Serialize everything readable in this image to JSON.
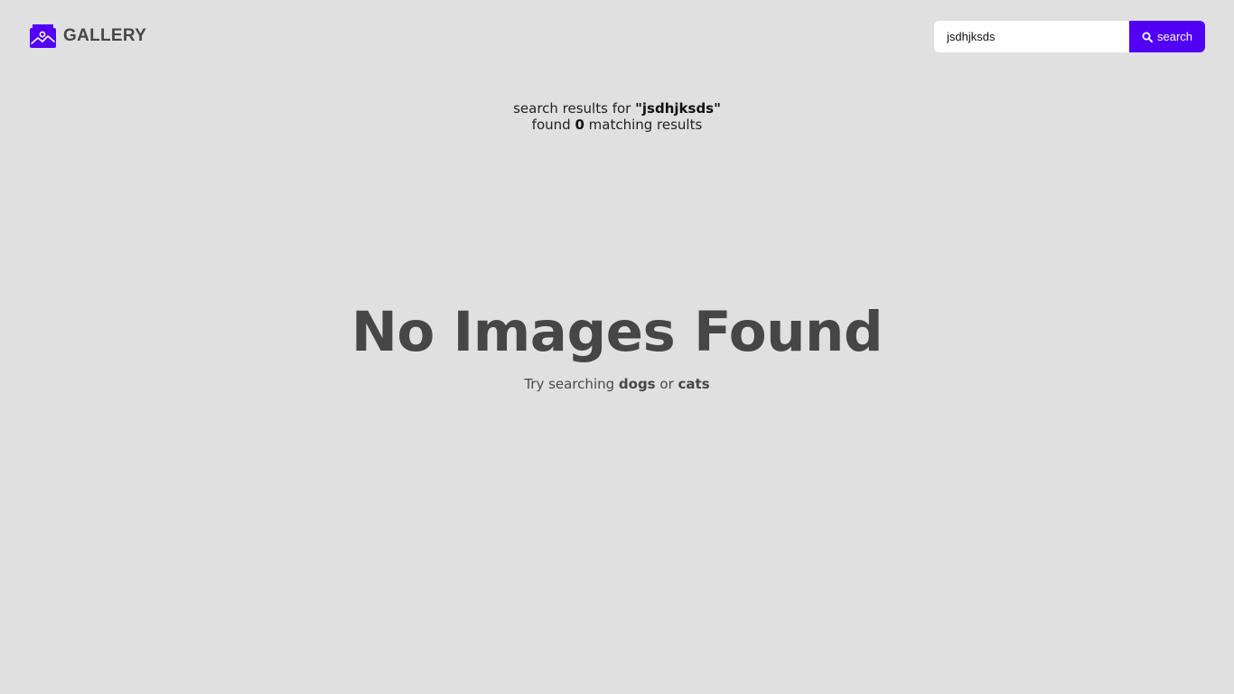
{
  "app": {
    "logo_text": "GALLERY",
    "logo_icon": "gallery-image-icon",
    "accent_color": "#5200f5"
  },
  "search": {
    "value": "jsdhjksds",
    "button_label": "search",
    "button_icon": "search-icon"
  },
  "results": {
    "prefix": "search results for ",
    "query_quoted": "\"jsdhjksds\"",
    "found_prefix": "found ",
    "count": "0",
    "found_suffix": " matching results"
  },
  "empty_state": {
    "title": "No Images Found",
    "hint_prefix": "Try searching ",
    "suggestion_1": "dogs",
    "hint_middle": " or ",
    "suggestion_2": "cats"
  }
}
